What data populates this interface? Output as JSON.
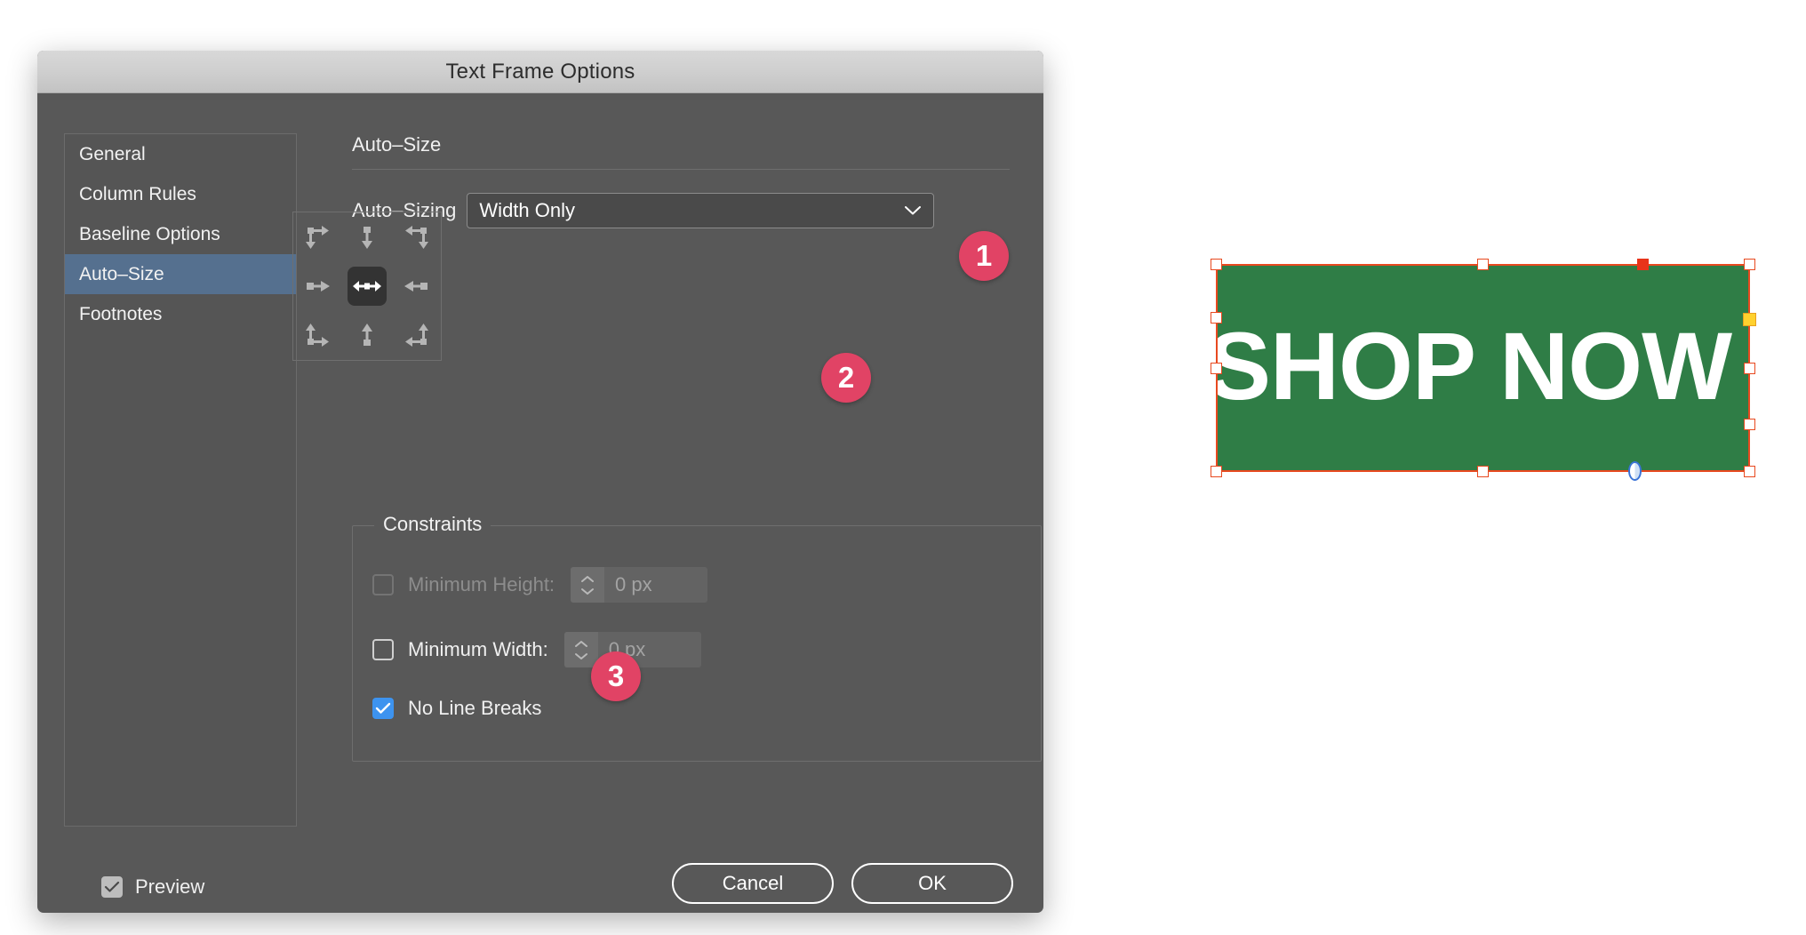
{
  "window": {
    "title": "Text Frame Options"
  },
  "sidebar": {
    "items": [
      {
        "label": "General",
        "selected": false
      },
      {
        "label": "Column Rules",
        "selected": false
      },
      {
        "label": "Baseline Options",
        "selected": false
      },
      {
        "label": "Auto–Size",
        "selected": true
      },
      {
        "label": "Footnotes",
        "selected": false
      }
    ]
  },
  "panel": {
    "section_title": "Auto–Size",
    "autosizing": {
      "label": "Auto–Sizing",
      "value": "Width Only",
      "chevron_icon": "chevron-down-icon"
    },
    "anchor_grid": {
      "cells": [
        {
          "name": "top-left",
          "icon": "resize-down-right-icon",
          "active": false
        },
        {
          "name": "top-center",
          "icon": "resize-down-icon",
          "active": false
        },
        {
          "name": "top-right",
          "icon": "resize-down-left-icon",
          "active": false
        },
        {
          "name": "middle-left",
          "icon": "resize-right-icon",
          "active": false
        },
        {
          "name": "middle-center",
          "icon": "resize-horizontal-icon",
          "active": true
        },
        {
          "name": "middle-right",
          "icon": "resize-left-icon",
          "active": false
        },
        {
          "name": "bottom-left",
          "icon": "resize-up-right-icon",
          "active": false
        },
        {
          "name": "bottom-center",
          "icon": "resize-up-icon",
          "active": false
        },
        {
          "name": "bottom-right",
          "icon": "resize-up-left-icon",
          "active": false
        }
      ]
    },
    "constraints": {
      "legend": "Constraints",
      "min_height": {
        "label": "Minimum Height:",
        "checked": false,
        "disabled": true,
        "value": "0 px"
      },
      "min_width": {
        "label": "Minimum Width:",
        "checked": false,
        "disabled": false,
        "value": "0 px"
      },
      "no_line_breaks": {
        "label": "No Line Breaks",
        "checked": true,
        "disabled": false
      }
    }
  },
  "footer": {
    "preview": {
      "label": "Preview",
      "checked": true
    },
    "cancel_label": "Cancel",
    "ok_label": "OK"
  },
  "canvas": {
    "text_frame": {
      "text": "SHOP NOW",
      "fill_color": "#2f7d46",
      "text_color": "#ffffff",
      "selection_color": "#e8491f"
    }
  },
  "callouts": [
    {
      "number": "1",
      "target": "auto-sizing-dropdown"
    },
    {
      "number": "2",
      "target": "anchor-grid"
    },
    {
      "number": "3",
      "target": "no-line-breaks-checkbox"
    }
  ],
  "colors": {
    "dialog_bg": "#585858",
    "sidebar_selection": "#55708f",
    "badge": "#e14365",
    "checkbox_blue": "#3d93ef",
    "frame_green": "#2f7d46",
    "handle_orange": "#e8491f",
    "handle_yellow": "#ffd12e"
  }
}
